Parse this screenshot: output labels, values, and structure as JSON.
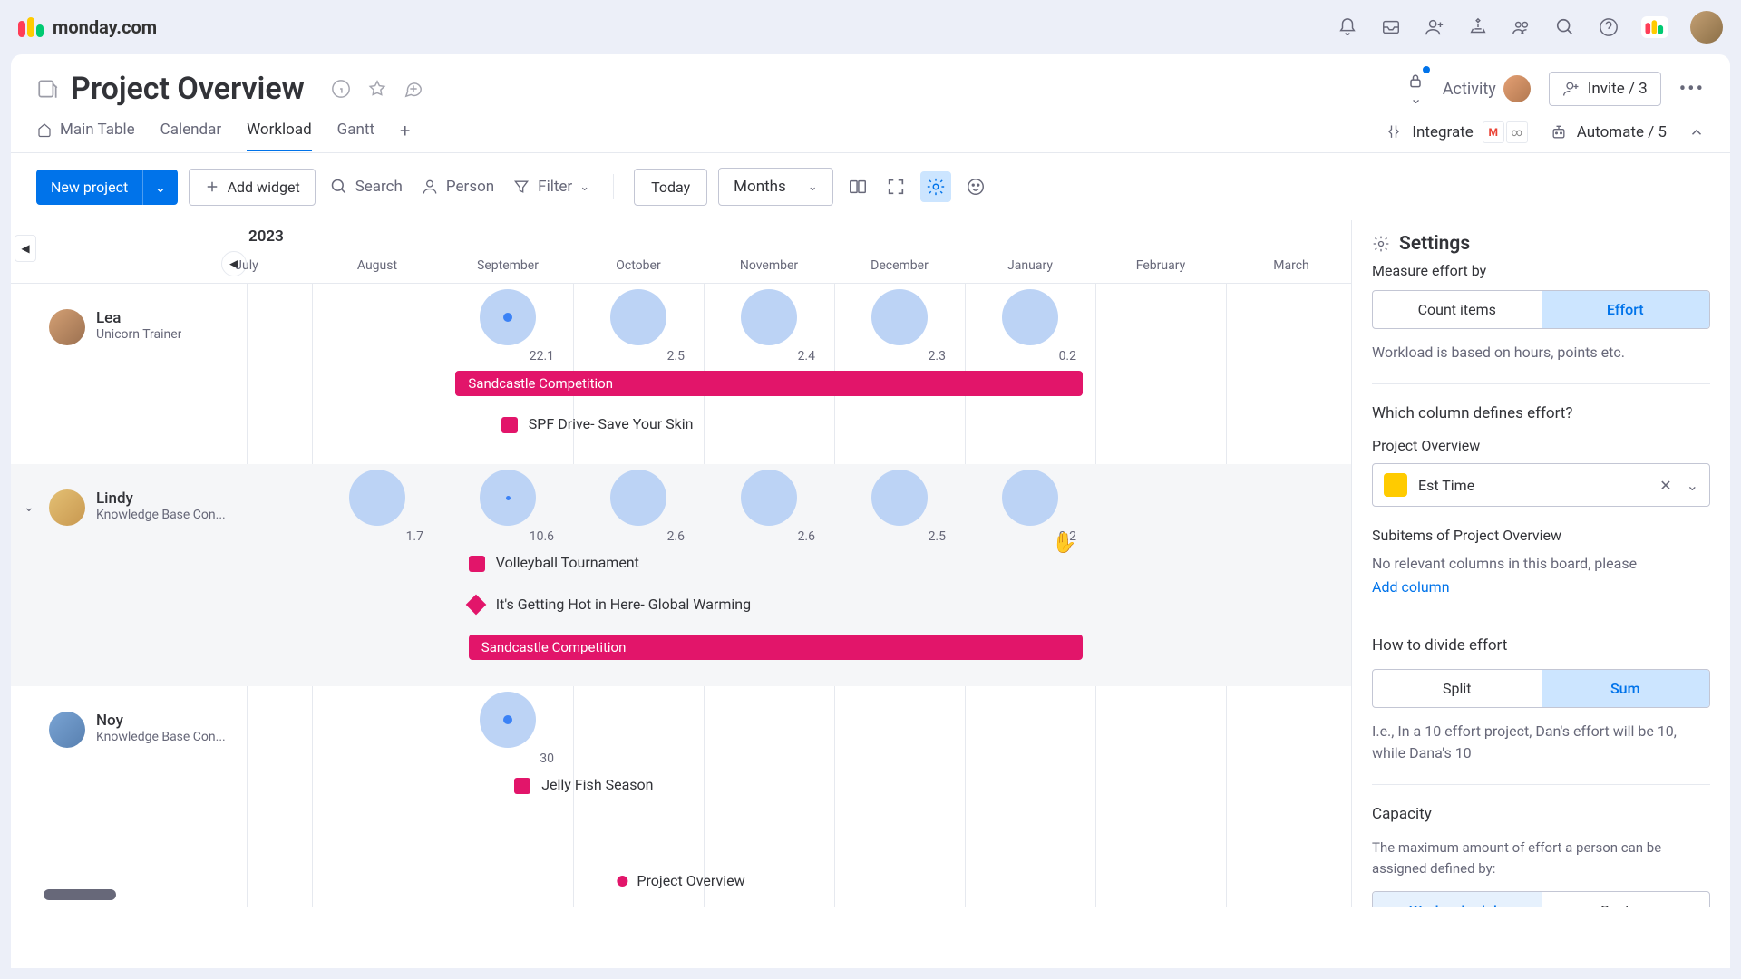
{
  "brand": "monday.com",
  "page_title": "Project Overview",
  "header": {
    "activity": "Activity",
    "invite": "Invite / 3"
  },
  "tabs": [
    {
      "label": "Main Table",
      "active": false,
      "has_icon": true
    },
    {
      "label": "Calendar",
      "active": false,
      "has_icon": false
    },
    {
      "label": "Workload",
      "active": true,
      "has_icon": false
    },
    {
      "label": "Gantt",
      "active": false,
      "has_icon": false
    }
  ],
  "integrate": "Integrate",
  "automate": "Automate / 5",
  "toolbar": {
    "new_project": "New project",
    "add_widget": "Add widget",
    "search": "Search",
    "person": "Person",
    "filter": "Filter",
    "today": "Today",
    "range": "Months"
  },
  "timeline": {
    "year": "2023",
    "months": [
      "July",
      "August",
      "September",
      "October",
      "November",
      "December",
      "January",
      "February",
      "March"
    ]
  },
  "people": [
    {
      "name": "Lea",
      "role": "Unicorn Trainer",
      "expanded": false,
      "bubbles": [
        {
          "month_idx": 2,
          "val": "22.1",
          "size": 62,
          "dot": true
        },
        {
          "month_idx": 3,
          "val": "2.5",
          "size": 62
        },
        {
          "month_idx": 4,
          "val": "2.4",
          "size": 62
        },
        {
          "month_idx": 5,
          "val": "2.3",
          "size": 62
        },
        {
          "month_idx": 6,
          "val": "0.2",
          "size": 62
        }
      ],
      "bars": [
        {
          "type": "bar",
          "label": "Sandcastle Competition",
          "from": 2,
          "to": 6,
          "row": 0,
          "inside": true
        },
        {
          "type": "square",
          "label": "SPF Drive- Save Your Skin",
          "from": 2.25,
          "row": 1
        }
      ]
    },
    {
      "name": "Lindy",
      "role": "Knowledge Base Con...",
      "expanded": true,
      "bubbles": [
        {
          "month_idx": 1,
          "val": "1.7",
          "size": 62
        },
        {
          "month_idx": 2,
          "val": "10.6",
          "size": 62,
          "dot_sm": true
        },
        {
          "month_idx": 3,
          "val": "2.6",
          "size": 62
        },
        {
          "month_idx": 4,
          "val": "2.6",
          "size": 62
        },
        {
          "month_idx": 5,
          "val": "2.5",
          "size": 62
        },
        {
          "month_idx": 6,
          "val": "0.2",
          "size": 62
        }
      ],
      "bars": [
        {
          "type": "square",
          "label": "Volleyball Tournament",
          "from": 2.0,
          "row": 0
        },
        {
          "type": "diamond",
          "label": "It's Getting Hot in Here- Global Warming",
          "from": 2.0,
          "row": 1
        },
        {
          "type": "bar",
          "label": "Sandcastle Competition",
          "from": 2.1,
          "to": 6,
          "row": 2,
          "inside": true
        }
      ]
    },
    {
      "name": "Noy",
      "role": "Knowledge Base Con...",
      "expanded": false,
      "bubbles": [
        {
          "month_idx": 2,
          "val": "30",
          "size": 62,
          "dot": true
        }
      ],
      "bars": [
        {
          "type": "square",
          "label": "Jelly Fish Season",
          "from": 2.35,
          "row": 0
        }
      ]
    }
  ],
  "legend": "Project Overview",
  "settings": {
    "title": "Settings",
    "measure_label": "Measure effort by",
    "measure_options": [
      "Count items",
      "Effort"
    ],
    "measure_hint": "Workload is based on hours, points etc.",
    "which_column": "Which column defines effort?",
    "board_name": "Project Overview",
    "selected_column": "Est Time",
    "subitems_label": "Subitems of Project Overview",
    "subitems_hint": "No relevant columns in this board, please",
    "add_column": "Add column",
    "divide_label": "How to divide effort",
    "divide_options": [
      "Split",
      "Sum"
    ],
    "divide_hint": "I.e., In a 10 effort project, Dan's effort will be 10, while Dana's 10",
    "capacity_label": "Capacity",
    "capacity_hint": "The maximum amount of effort a person can be assigned defined by:",
    "capacity_options": [
      "Work schedule",
      "Custom"
    ]
  }
}
